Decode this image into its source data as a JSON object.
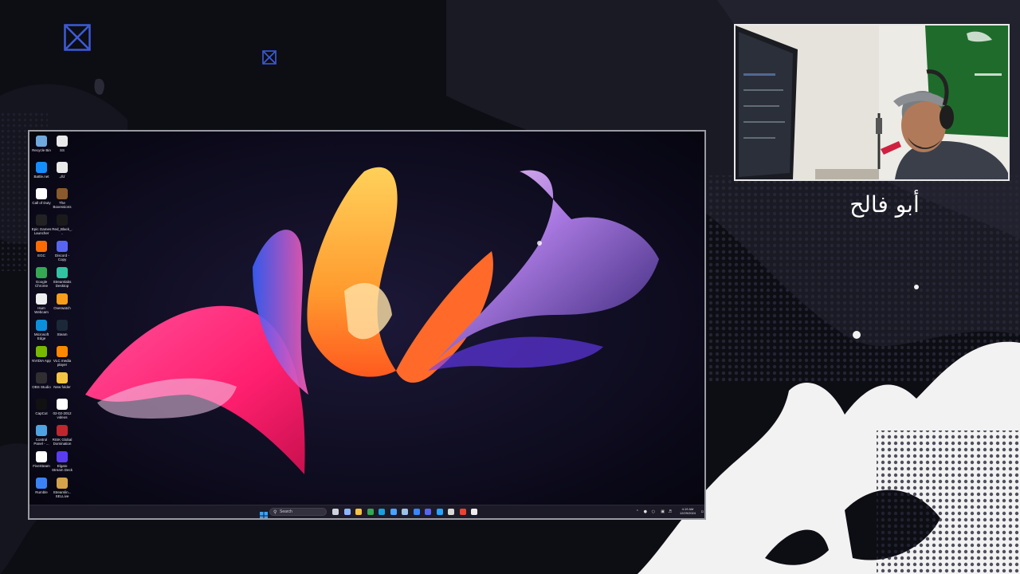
{
  "overlay": {
    "streamer_name": "أبو فالح",
    "deco_icons": [
      "broken-image-icon",
      "broken-image-icon"
    ]
  },
  "desktop": {
    "icons": [
      {
        "label": "Recycle Bin",
        "icon": "recycle-bin-icon",
        "color": "#6fa8dc"
      },
      {
        "label": "SS",
        "icon": "file-icon",
        "color": "#e9e9e9"
      },
      {
        "label": "Battle.net",
        "icon": "battlenet-icon",
        "color": "#148eff"
      },
      {
        "label": "كاك",
        "icon": "file-icon",
        "color": "#e9e9e9"
      },
      {
        "label": "Call of Duty",
        "icon": "file-icon",
        "color": "#ffffff"
      },
      {
        "label": "The Boxessions",
        "icon": "game-icon",
        "color": "#8a5a2b"
      },
      {
        "label": "Epic Games Launcher",
        "icon": "epic-games-icon",
        "color": "#222222"
      },
      {
        "label": "Red_Black_...",
        "icon": "file-icon",
        "color": "#1a1a1a"
      },
      {
        "label": "EGC",
        "icon": "app-icon",
        "color": "#ff6a00"
      },
      {
        "label": "Discord - Copy",
        "icon": "discord-icon",
        "color": "#5865f2"
      },
      {
        "label": "Google Chrome",
        "icon": "chrome-icon",
        "color": "#34a853"
      },
      {
        "label": "Streamlabs Desktop",
        "icon": "streamlabs-icon",
        "color": "#31c3a2"
      },
      {
        "label": "Hum Webcam",
        "icon": "webcam-icon",
        "color": "#eeeeee"
      },
      {
        "label": "Overwatch",
        "icon": "overwatch-icon",
        "color": "#f99e1a"
      },
      {
        "label": "Microsoft Edge",
        "icon": "edge-icon",
        "color": "#0c8fdb"
      },
      {
        "label": "Steam",
        "icon": "steam-icon",
        "color": "#1b2838"
      },
      {
        "label": "NVIDIA App",
        "icon": "nvidia-icon",
        "color": "#76b900"
      },
      {
        "label": "VLC media player",
        "icon": "vlc-icon",
        "color": "#ff8800"
      },
      {
        "label": "OBS Studio",
        "icon": "obs-icon",
        "color": "#302e31"
      },
      {
        "label": "New folder",
        "icon": "folder-icon",
        "color": "#f4c542"
      },
      {
        "label": "CapCut",
        "icon": "capcut-icon",
        "color": "#111111"
      },
      {
        "label": "02-02-2012 videos",
        "icon": "chrome-icon",
        "color": "#ffffff"
      },
      {
        "label": "Control Panel - ...",
        "icon": "control-panel-icon",
        "color": "#4fa3e0"
      },
      {
        "label": "RISK Global Domination",
        "icon": "risk-icon",
        "color": "#c0262d"
      },
      {
        "label": "FiveSteam",
        "icon": "app-icon",
        "color": "#ffffff"
      },
      {
        "label": "Elgato Stream Deck",
        "icon": "stream-deck-icon",
        "color": "#5a3df0"
      },
      {
        "label": "Rumble",
        "icon": "rumble-icon",
        "color": "#3b82f6"
      },
      {
        "label": "Streamlin... SELLive",
        "icon": "app-icon",
        "color": "#d4a24a"
      }
    ]
  },
  "taskbar": {
    "search_placeholder": "Search",
    "apps": [
      {
        "icon": "task-view-icon",
        "color": "#cfd3dd"
      },
      {
        "icon": "widgets-icon",
        "color": "#8fb5ff"
      },
      {
        "icon": "file-explorer-icon",
        "color": "#f4c542"
      },
      {
        "icon": "chrome-icon",
        "color": "#34a853"
      },
      {
        "icon": "edge-icon",
        "color": "#19a0e0"
      },
      {
        "icon": "store-icon",
        "color": "#4aa3ff"
      },
      {
        "icon": "steam-icon",
        "color": "#9ec3e6"
      },
      {
        "icon": "mail-icon",
        "color": "#3a86ff"
      },
      {
        "icon": "discord-icon",
        "color": "#5865f2"
      },
      {
        "icon": "battlenet-icon",
        "color": "#2aa4ff"
      },
      {
        "icon": "obs-icon",
        "color": "#d8d8d8"
      },
      {
        "icon": "chrome-icon",
        "color": "#ea4335"
      },
      {
        "icon": "obs-icon",
        "color": "#eeeeee"
      }
    ],
    "time": "4:19 AM",
    "date": "12/29/2024"
  },
  "colors": {
    "accent_blue": "#3d5bd9",
    "frame": "#9a9aa3",
    "taskbar": "#1c1a26",
    "overlay_bg": "#0d0d14"
  }
}
